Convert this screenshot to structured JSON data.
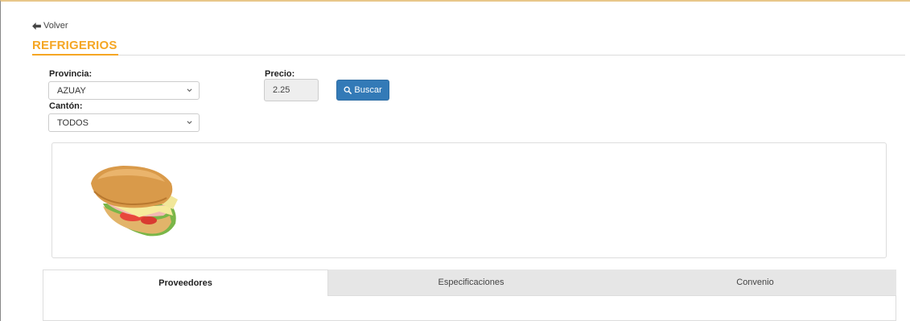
{
  "nav": {
    "back_label": "Volver",
    "back_icon": "arrow-left-icon"
  },
  "page": {
    "title": "REFRIGERIOS"
  },
  "filters": {
    "provincia_label": "Provincia:",
    "provincia_value": "AZUAY",
    "canton_label": "Cantón:",
    "canton_value": "TODOS",
    "precio_label": "Precio:",
    "precio_value": "2.25",
    "search_label": "Buscar",
    "search_icon": "search-icon"
  },
  "product_image": {
    "alt": "sandwich",
    "icon": "sandwich-image"
  },
  "tabs": [
    {
      "label": "Proveedores",
      "active": true
    },
    {
      "label": "Especificaciones",
      "active": false
    },
    {
      "label": "Convenio",
      "active": false
    }
  ],
  "colors": {
    "accent": "#f5a623",
    "primary_button": "#337ab7",
    "inactive_tab": "#e6e6e6"
  }
}
